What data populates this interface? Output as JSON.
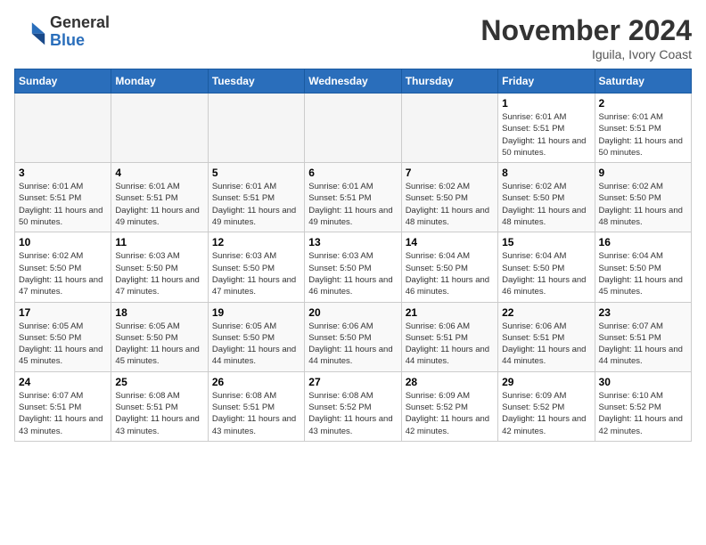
{
  "header": {
    "logo": {
      "general": "General",
      "blue": "Blue"
    },
    "month": "November 2024",
    "location": "Iguila, Ivory Coast"
  },
  "days_of_week": [
    "Sunday",
    "Monday",
    "Tuesday",
    "Wednesday",
    "Thursday",
    "Friday",
    "Saturday"
  ],
  "weeks": [
    [
      {
        "day": "",
        "empty": true
      },
      {
        "day": "",
        "empty": true
      },
      {
        "day": "",
        "empty": true
      },
      {
        "day": "",
        "empty": true
      },
      {
        "day": "",
        "empty": true
      },
      {
        "day": "1",
        "sunrise": "Sunrise: 6:01 AM",
        "sunset": "Sunset: 5:51 PM",
        "daylight": "Daylight: 11 hours and 50 minutes."
      },
      {
        "day": "2",
        "sunrise": "Sunrise: 6:01 AM",
        "sunset": "Sunset: 5:51 PM",
        "daylight": "Daylight: 11 hours and 50 minutes."
      }
    ],
    [
      {
        "day": "3",
        "sunrise": "Sunrise: 6:01 AM",
        "sunset": "Sunset: 5:51 PM",
        "daylight": "Daylight: 11 hours and 50 minutes."
      },
      {
        "day": "4",
        "sunrise": "Sunrise: 6:01 AM",
        "sunset": "Sunset: 5:51 PM",
        "daylight": "Daylight: 11 hours and 49 minutes."
      },
      {
        "day": "5",
        "sunrise": "Sunrise: 6:01 AM",
        "sunset": "Sunset: 5:51 PM",
        "daylight": "Daylight: 11 hours and 49 minutes."
      },
      {
        "day": "6",
        "sunrise": "Sunrise: 6:01 AM",
        "sunset": "Sunset: 5:51 PM",
        "daylight": "Daylight: 11 hours and 49 minutes."
      },
      {
        "day": "7",
        "sunrise": "Sunrise: 6:02 AM",
        "sunset": "Sunset: 5:50 PM",
        "daylight": "Daylight: 11 hours and 48 minutes."
      },
      {
        "day": "8",
        "sunrise": "Sunrise: 6:02 AM",
        "sunset": "Sunset: 5:50 PM",
        "daylight": "Daylight: 11 hours and 48 minutes."
      },
      {
        "day": "9",
        "sunrise": "Sunrise: 6:02 AM",
        "sunset": "Sunset: 5:50 PM",
        "daylight": "Daylight: 11 hours and 48 minutes."
      }
    ],
    [
      {
        "day": "10",
        "sunrise": "Sunrise: 6:02 AM",
        "sunset": "Sunset: 5:50 PM",
        "daylight": "Daylight: 11 hours and 47 minutes."
      },
      {
        "day": "11",
        "sunrise": "Sunrise: 6:03 AM",
        "sunset": "Sunset: 5:50 PM",
        "daylight": "Daylight: 11 hours and 47 minutes."
      },
      {
        "day": "12",
        "sunrise": "Sunrise: 6:03 AM",
        "sunset": "Sunset: 5:50 PM",
        "daylight": "Daylight: 11 hours and 47 minutes."
      },
      {
        "day": "13",
        "sunrise": "Sunrise: 6:03 AM",
        "sunset": "Sunset: 5:50 PM",
        "daylight": "Daylight: 11 hours and 46 minutes."
      },
      {
        "day": "14",
        "sunrise": "Sunrise: 6:04 AM",
        "sunset": "Sunset: 5:50 PM",
        "daylight": "Daylight: 11 hours and 46 minutes."
      },
      {
        "day": "15",
        "sunrise": "Sunrise: 6:04 AM",
        "sunset": "Sunset: 5:50 PM",
        "daylight": "Daylight: 11 hours and 46 minutes."
      },
      {
        "day": "16",
        "sunrise": "Sunrise: 6:04 AM",
        "sunset": "Sunset: 5:50 PM",
        "daylight": "Daylight: 11 hours and 45 minutes."
      }
    ],
    [
      {
        "day": "17",
        "sunrise": "Sunrise: 6:05 AM",
        "sunset": "Sunset: 5:50 PM",
        "daylight": "Daylight: 11 hours and 45 minutes."
      },
      {
        "day": "18",
        "sunrise": "Sunrise: 6:05 AM",
        "sunset": "Sunset: 5:50 PM",
        "daylight": "Daylight: 11 hours and 45 minutes."
      },
      {
        "day": "19",
        "sunrise": "Sunrise: 6:05 AM",
        "sunset": "Sunset: 5:50 PM",
        "daylight": "Daylight: 11 hours and 44 minutes."
      },
      {
        "day": "20",
        "sunrise": "Sunrise: 6:06 AM",
        "sunset": "Sunset: 5:50 PM",
        "daylight": "Daylight: 11 hours and 44 minutes."
      },
      {
        "day": "21",
        "sunrise": "Sunrise: 6:06 AM",
        "sunset": "Sunset: 5:51 PM",
        "daylight": "Daylight: 11 hours and 44 minutes."
      },
      {
        "day": "22",
        "sunrise": "Sunrise: 6:06 AM",
        "sunset": "Sunset: 5:51 PM",
        "daylight": "Daylight: 11 hours and 44 minutes."
      },
      {
        "day": "23",
        "sunrise": "Sunrise: 6:07 AM",
        "sunset": "Sunset: 5:51 PM",
        "daylight": "Daylight: 11 hours and 44 minutes."
      }
    ],
    [
      {
        "day": "24",
        "sunrise": "Sunrise: 6:07 AM",
        "sunset": "Sunset: 5:51 PM",
        "daylight": "Daylight: 11 hours and 43 minutes."
      },
      {
        "day": "25",
        "sunrise": "Sunrise: 6:08 AM",
        "sunset": "Sunset: 5:51 PM",
        "daylight": "Daylight: 11 hours and 43 minutes."
      },
      {
        "day": "26",
        "sunrise": "Sunrise: 6:08 AM",
        "sunset": "Sunset: 5:51 PM",
        "daylight": "Daylight: 11 hours and 43 minutes."
      },
      {
        "day": "27",
        "sunrise": "Sunrise: 6:08 AM",
        "sunset": "Sunset: 5:52 PM",
        "daylight": "Daylight: 11 hours and 43 minutes."
      },
      {
        "day": "28",
        "sunrise": "Sunrise: 6:09 AM",
        "sunset": "Sunset: 5:52 PM",
        "daylight": "Daylight: 11 hours and 42 minutes."
      },
      {
        "day": "29",
        "sunrise": "Sunrise: 6:09 AM",
        "sunset": "Sunset: 5:52 PM",
        "daylight": "Daylight: 11 hours and 42 minutes."
      },
      {
        "day": "30",
        "sunrise": "Sunrise: 6:10 AM",
        "sunset": "Sunset: 5:52 PM",
        "daylight": "Daylight: 11 hours and 42 minutes."
      }
    ]
  ]
}
